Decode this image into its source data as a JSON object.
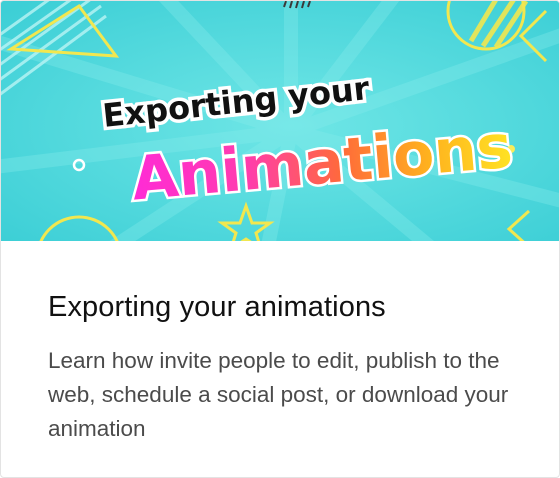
{
  "card": {
    "image_text_line1": "Exporting your",
    "image_text_line2": "Animations",
    "title": "Exporting your animations",
    "description": "Learn how invite people to edit, publish to the web, schedule a social post, or download your animation"
  },
  "colors": {
    "hero_background": "#4fd9dd",
    "title_text": "#111111",
    "description_text": "#4b4b4b"
  }
}
